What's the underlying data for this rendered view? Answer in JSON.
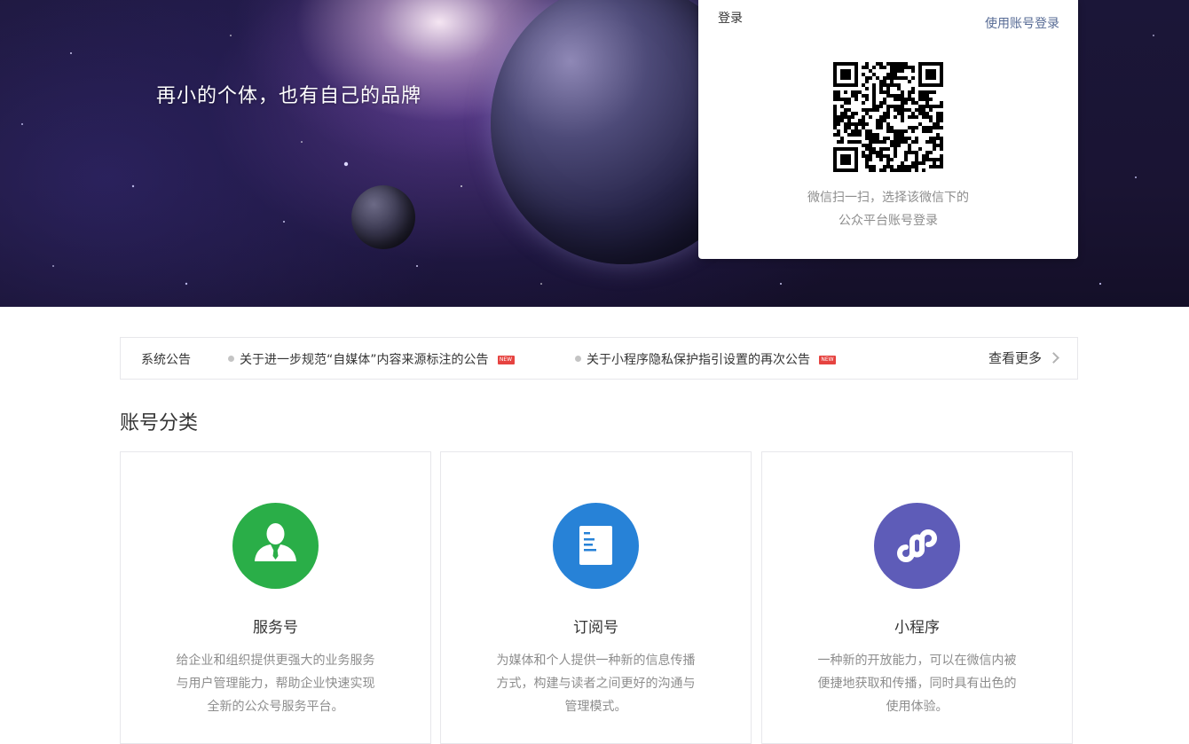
{
  "hero": {
    "slogan": "再小的个体，也有自己的品牌"
  },
  "login": {
    "title": "登录",
    "switch_link": "使用账号登录",
    "tip_line1": "微信扫一扫，选择该微信下的",
    "tip_line2": "公众平台账号登录"
  },
  "notice": {
    "label": "系统公告",
    "items": [
      {
        "text": "关于进一步规范“自媒体”内容来源标注的公告",
        "badge": "NEW"
      },
      {
        "text": "关于小程序隐私保护指引设置的再次公告",
        "badge": "NEW"
      }
    ],
    "more": "查看更多"
  },
  "categories": {
    "title": "账号分类",
    "cards": [
      {
        "name": "服务号",
        "icon": "user-icon",
        "color": "#2aae48",
        "desc": [
          "给企业和组织提供更强大的业务服务",
          "与用户管理能力，帮助企业快速实现",
          "全新的公众号服务平台。"
        ]
      },
      {
        "name": "订阅号",
        "icon": "document-icon",
        "color": "#2782d7",
        "desc": [
          "为媒体和个人提供一种新的信息传播",
          "方式，构建与读者之间更好的沟通与",
          "管理模式。"
        ]
      },
      {
        "name": "小程序",
        "icon": "miniprogram-icon",
        "color": "#6467ef",
        "desc": [
          "一种新的开放能力，可以在微信内被",
          "便捷地获取和传播，同时具有出色的",
          "使用体验。"
        ]
      }
    ]
  }
}
